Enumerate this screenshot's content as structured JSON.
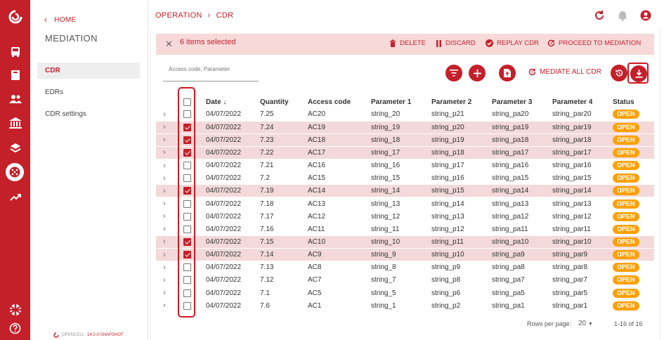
{
  "app": {
    "module_title": "MEDIATION",
    "home_label": "HOME",
    "brand_name": "OPENCELL",
    "brand_version": "14.0.0-SNAPSHOT",
    "accent_color": "#c4202a"
  },
  "rail": {
    "icons": [
      "opencell-logo-icon",
      "bus-icon",
      "book-icon",
      "users-icon",
      "bank-icon",
      "layers-icon",
      "mediation-icon",
      "trend-icon",
      "language-icon",
      "help-icon"
    ]
  },
  "sidebar": {
    "items": [
      {
        "label": "CDR",
        "active": true
      },
      {
        "label": "EDRs",
        "active": false
      },
      {
        "label": "CDR settings",
        "active": false
      }
    ]
  },
  "breadcrumb": {
    "parent": "OPERATION",
    "current": "CDR"
  },
  "selection": {
    "count_label": "6 items selected",
    "actions": [
      "DELETE",
      "DISCARD",
      "REPLAY CDR",
      "PROCEED TO MEDIATION"
    ]
  },
  "toolbar": {
    "search_placeholder": "Access code, Parameter",
    "mediate_all_label": "MEDIATE ALL CDR"
  },
  "table": {
    "headers": [
      "Date",
      "Quantity",
      "Access code",
      "Parameter 1",
      "Parameter 2",
      "Parameter 3",
      "Parameter 4",
      "Status"
    ],
    "sort_indicator": "↓",
    "rows": [
      {
        "selected": false,
        "date": "04/07/2022",
        "quantity": "7.25",
        "access_code": "AC20",
        "p1": "string_20",
        "p2": "string_p21",
        "p3": "string_pa20",
        "p4": "string_par20",
        "status": "OPEN"
      },
      {
        "selected": true,
        "date": "04/07/2022",
        "quantity": "7.24",
        "access_code": "AC19",
        "p1": "string_19",
        "p2": "string_p20",
        "p3": "string_pa19",
        "p4": "string_par19",
        "status": "OPEN"
      },
      {
        "selected": true,
        "date": "04/07/2022",
        "quantity": "7.23",
        "access_code": "AC18",
        "p1": "string_18",
        "p2": "string_p19",
        "p3": "string_pa18",
        "p4": "string_par18",
        "status": "OPEN"
      },
      {
        "selected": true,
        "date": "04/07/2022",
        "quantity": "7.22",
        "access_code": "AC17",
        "p1": "string_17",
        "p2": "string_p18",
        "p3": "string_pa17",
        "p4": "string_par17",
        "status": "OPEN"
      },
      {
        "selected": false,
        "date": "04/07/2022",
        "quantity": "7.21",
        "access_code": "AC16",
        "p1": "string_16",
        "p2": "string_p17",
        "p3": "string_pa16",
        "p4": "string_par16",
        "status": "OPEN"
      },
      {
        "selected": false,
        "date": "04/07/2022",
        "quantity": "7.2",
        "access_code": "AC15",
        "p1": "string_15",
        "p2": "string_p16",
        "p3": "string_pa15",
        "p4": "string_par15",
        "status": "OPEN"
      },
      {
        "selected": true,
        "date": "04/07/2022",
        "quantity": "7.19",
        "access_code": "AC14",
        "p1": "string_14",
        "p2": "string_p15",
        "p3": "string_pa14",
        "p4": "string_par14",
        "status": "OPEN"
      },
      {
        "selected": false,
        "date": "04/07/2022",
        "quantity": "7.18",
        "access_code": "AC13",
        "p1": "string_13",
        "p2": "string_p14",
        "p3": "string_pa13",
        "p4": "string_par13",
        "status": "OPEN"
      },
      {
        "selected": false,
        "date": "04/07/2022",
        "quantity": "7.17",
        "access_code": "AC12",
        "p1": "string_12",
        "p2": "string_p13",
        "p3": "string_pa12",
        "p4": "string_par12",
        "status": "OPEN"
      },
      {
        "selected": false,
        "date": "04/07/2022",
        "quantity": "7.16",
        "access_code": "AC11",
        "p1": "string_11",
        "p2": "string_p12",
        "p3": "string_pa11",
        "p4": "string_par11",
        "status": "OPEN"
      },
      {
        "selected": true,
        "date": "04/07/2022",
        "quantity": "7.15",
        "access_code": "AC10",
        "p1": "string_10",
        "p2": "string_p11",
        "p3": "string_pa10",
        "p4": "string_par10",
        "status": "OPEN"
      },
      {
        "selected": true,
        "date": "04/07/2022",
        "quantity": "7.14",
        "access_code": "AC9",
        "p1": "string_9",
        "p2": "string_p10",
        "p3": "string_pa9",
        "p4": "string_par9",
        "status": "OPEN"
      },
      {
        "selected": false,
        "date": "04/07/2022",
        "quantity": "7.13",
        "access_code": "AC8",
        "p1": "string_8",
        "p2": "string_p9",
        "p3": "string_pa8",
        "p4": "string_par8",
        "status": "OPEN"
      },
      {
        "selected": false,
        "date": "04/07/2022",
        "quantity": "7.12",
        "access_code": "AC7",
        "p1": "string_7",
        "p2": "string_p8",
        "p3": "string_pa7",
        "p4": "string_par7",
        "status": "OPEN"
      },
      {
        "selected": false,
        "date": "04/07/2022",
        "quantity": "7.1",
        "access_code": "AC5",
        "p1": "string_5",
        "p2": "string_p6",
        "p3": "string_pa5",
        "p4": "string_par5",
        "status": "OPEN"
      },
      {
        "selected": false,
        "date": "04/07/2022",
        "quantity": "7.6",
        "access_code": "AC1",
        "p1": "string_1",
        "p2": "string_p2",
        "p3": "string_pa1",
        "p4": "string_par1",
        "status": "OPEN"
      }
    ]
  },
  "pagination": {
    "rows_per_page_label": "Rows per page:",
    "rows_per_page_value": "20",
    "range_label": "1-16 of 16"
  }
}
